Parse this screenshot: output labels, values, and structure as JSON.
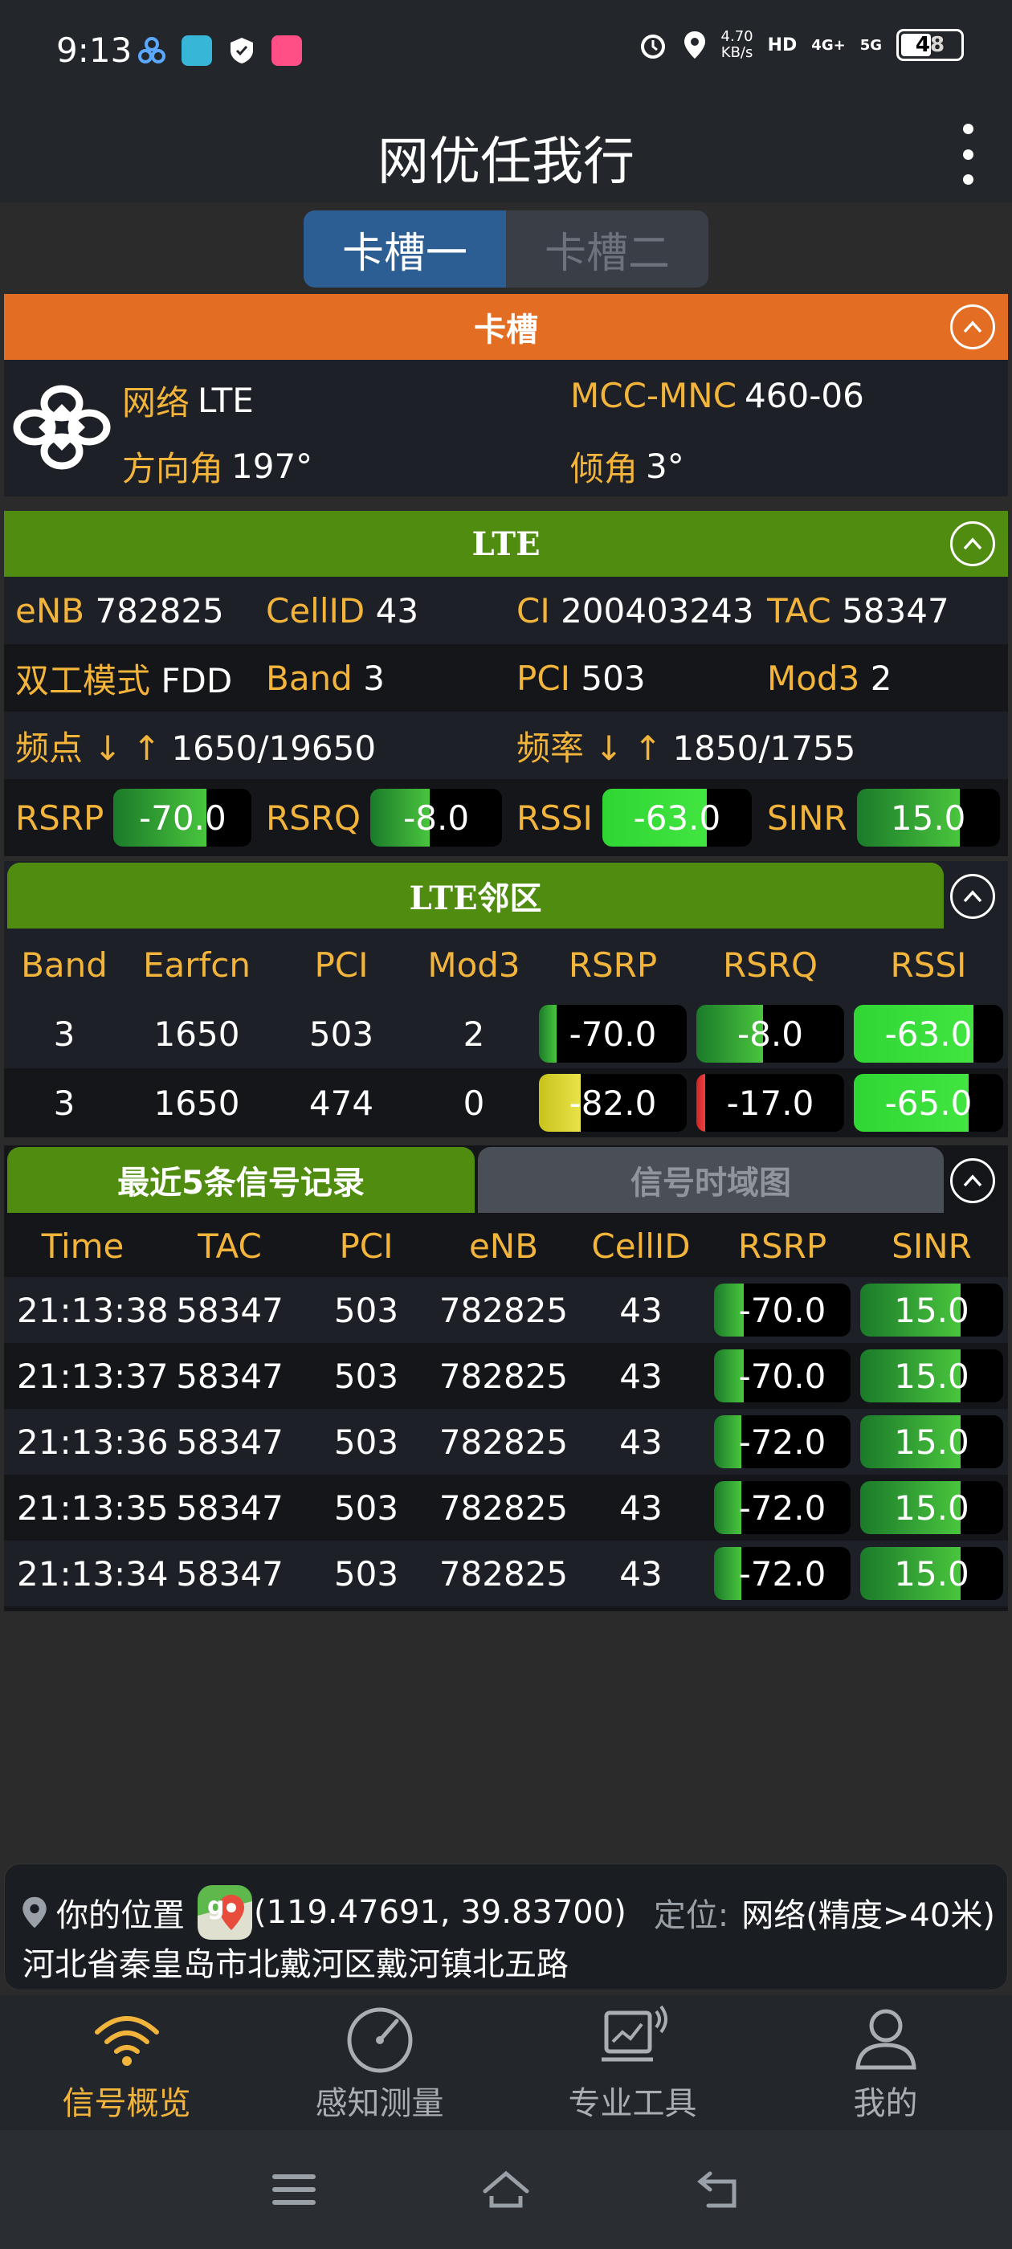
{
  "status": {
    "time": "9:13",
    "speed": "4.70",
    "speed_unit": "KB/s",
    "hd": "HD",
    "net1": "4G+",
    "net2": "5G",
    "battery": "48"
  },
  "app": {
    "title": "网优任我行"
  },
  "sim_tabs": [
    {
      "label": "卡槽一"
    },
    {
      "label": "卡槽二"
    }
  ],
  "sim_section": {
    "header": "卡槽",
    "network_label": "网络",
    "network_value": "LTE",
    "mccmnc_label": "MCC-MNC",
    "mccmnc_value": "460-06",
    "azimuth_label": "方向角",
    "azimuth_value": "197°",
    "tilt_label": "倾角",
    "tilt_value": "3°"
  },
  "lte_section": {
    "header": "LTE",
    "enb_label": "eNB",
    "enb_value": "782825",
    "cellid_label": "CellID",
    "cellid_value": "43",
    "ci_label": "CI",
    "ci_value": "200403243",
    "tac_label": "TAC",
    "tac_value": "58347",
    "duplex_label": "双工模式",
    "duplex_value": "FDD",
    "band_label": "Band",
    "band_value": "3",
    "pci_label": "PCI",
    "pci_value": "503",
    "mod3_label": "Mod3",
    "mod3_value": "2",
    "freqpoint_label": "频点 ↓ ↑",
    "freqpoint_value": "1650/19650",
    "freq_label": "频率 ↓ ↑",
    "freq_value": "1850/1755",
    "rsrp_label": "RSRP",
    "rsrp_value": "-70.0",
    "rsrp_level": 0.67,
    "rsrq_label": "RSRQ",
    "rsrq_value": "-8.0",
    "rsrq_level": 0.45,
    "rssi_label": "RSSI",
    "rssi_value": "-63.0",
    "rssi_level": 0.7,
    "sinr_label": "SINR",
    "sinr_value": "15.0",
    "sinr_level": 0.72
  },
  "neighbor_section": {
    "header": "LTE邻区",
    "columns": [
      "Band",
      "Earfcn",
      "PCI",
      "Mod3",
      "RSRP",
      "RSRQ",
      "RSSI"
    ],
    "rows": [
      {
        "band": "3",
        "earfcn": "1650",
        "pci": "503",
        "mod3": "2",
        "rsrp": "-70.0",
        "rsrq": "-8.0",
        "rssi": "-63.0"
      },
      {
        "band": "3",
        "earfcn": "1650",
        "pci": "474",
        "mod3": "0",
        "rsrp": "-82.0",
        "rsrq": "-17.0",
        "rssi": "-65.0"
      }
    ]
  },
  "records_section": {
    "tab_active": "最近5条信号记录",
    "tab_inactive": "信号时域图",
    "columns": [
      "Time",
      "TAC",
      "PCI",
      "eNB",
      "CellID",
      "RSRP",
      "SINR"
    ],
    "rows": [
      {
        "time": "21:13:38",
        "tac": "58347",
        "pci": "503",
        "enb": "782825",
        "cellid": "43",
        "rsrp": "-70.0",
        "sinr": "15.0"
      },
      {
        "time": "21:13:37",
        "tac": "58347",
        "pci": "503",
        "enb": "782825",
        "cellid": "43",
        "rsrp": "-70.0",
        "sinr": "15.0"
      },
      {
        "time": "21:13:36",
        "tac": "58347",
        "pci": "503",
        "enb": "782825",
        "cellid": "43",
        "rsrp": "-72.0",
        "sinr": "15.0"
      },
      {
        "time": "21:13:35",
        "tac": "58347",
        "pci": "503",
        "enb": "782825",
        "cellid": "43",
        "rsrp": "-72.0",
        "sinr": "15.0"
      },
      {
        "time": "21:13:34",
        "tac": "58347",
        "pci": "503",
        "enb": "782825",
        "cellid": "43",
        "rsrp": "-72.0",
        "sinr": "15.0"
      }
    ]
  },
  "location": {
    "label": "你的位置",
    "coords": "(119.47691, 39.83700)",
    "loc_label": "定位:",
    "loc_value": "网络(精度>40米)",
    "address": "河北省秦皇岛市北戴河区戴河镇北五路"
  },
  "bottom_nav": [
    {
      "label": "信号概览",
      "icon": "wifi-icon"
    },
    {
      "label": "感知测量",
      "icon": "speedometer-icon"
    },
    {
      "label": "专业工具",
      "icon": "monitor-chart-icon"
    },
    {
      "label": "我的",
      "icon": "user-icon"
    }
  ],
  "colors": {
    "orange_header": "#e36d23",
    "green_header": "#4f8c0f",
    "label_gold": "#f2b43a",
    "tab_blue": "#2c5d93"
  }
}
